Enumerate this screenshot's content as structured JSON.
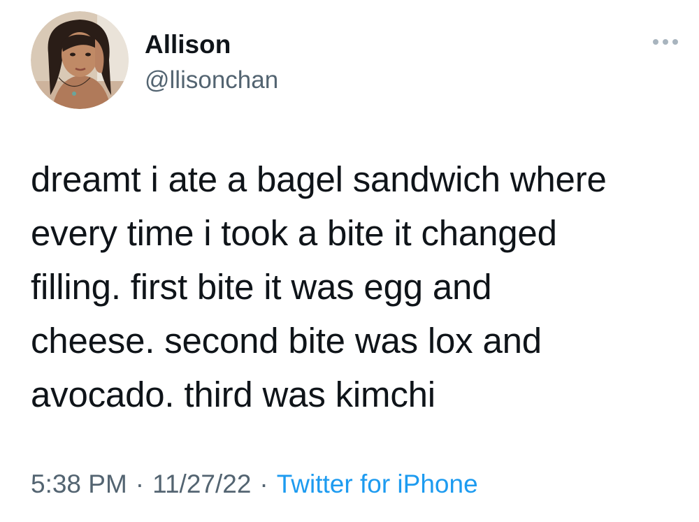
{
  "author": {
    "display_name": "Allison",
    "handle": "@llisonchan"
  },
  "tweet": {
    "text": "dreamt i ate a bagel sandwich where\nevery time i took a bite it changed\nfilling. first bite it was egg and\ncheese. second bite was lox and\navocado. third was kimchi"
  },
  "meta": {
    "time": "5:38 PM",
    "separator": "·",
    "date": "11/27/22",
    "source": "Twitter for iPhone"
  },
  "icons": {
    "more": "more-horizontal-icon"
  },
  "colors": {
    "text_primary": "#0f1419",
    "text_secondary": "#536471",
    "link": "#1d9bf0"
  }
}
